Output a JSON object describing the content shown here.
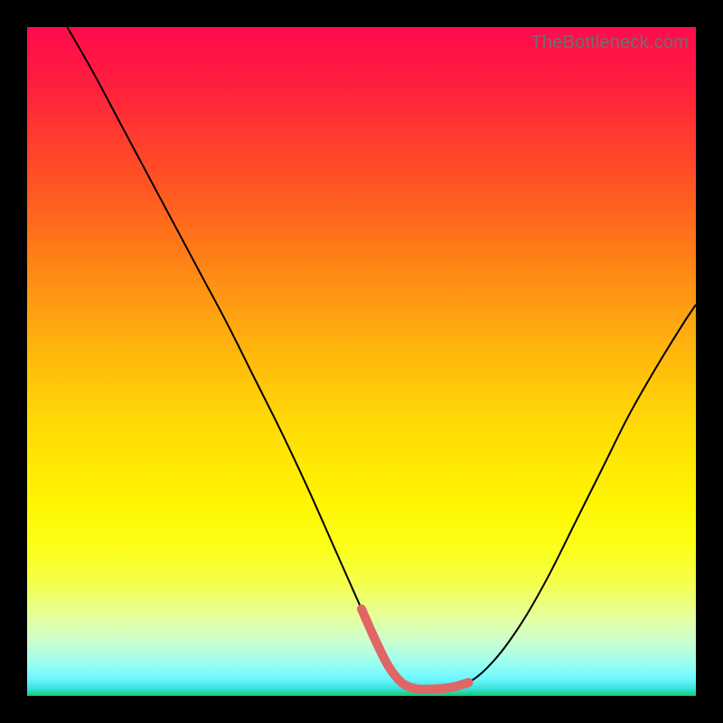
{
  "watermark": "TheBottleneck.com",
  "chart_data": {
    "type": "line",
    "title": "",
    "xlabel": "",
    "ylabel": "",
    "xlim": [
      0,
      100
    ],
    "ylim": [
      0,
      100
    ],
    "grid": false,
    "series": [
      {
        "name": "bottleneck-curve",
        "color": "#000000",
        "width": 2,
        "x": [
          6,
          10,
          14,
          18,
          22,
          26,
          30,
          34,
          38,
          42,
          46,
          50,
          52,
          54,
          56,
          58,
          60,
          62,
          66,
          70,
          74,
          78,
          82,
          86,
          90,
          94,
          98,
          100
        ],
        "y": [
          100,
          93,
          85.5,
          78,
          70.5,
          63,
          55.5,
          47.5,
          39.5,
          31,
          22,
          13,
          8.5,
          4.5,
          2,
          1.1,
          1,
          1.1,
          2,
          5.5,
          11,
          18,
          26,
          34,
          42,
          49,
          55.5,
          58.5
        ]
      },
      {
        "name": "highlight-segment",
        "color": "#e06666",
        "width": 10,
        "linecap": "round",
        "x": [
          50,
          52,
          54,
          56,
          58,
          60,
          62,
          64,
          66
        ],
        "y": [
          13,
          8.5,
          4.5,
          2,
          1.1,
          1,
          1.1,
          1.4,
          2
        ]
      }
    ]
  }
}
